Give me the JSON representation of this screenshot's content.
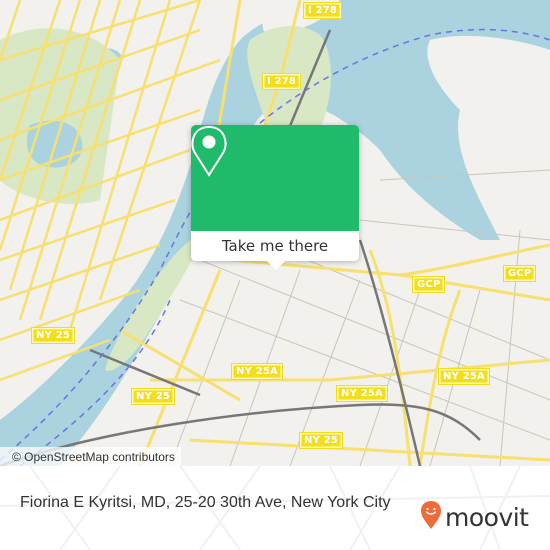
{
  "map": {
    "highway_shields": [
      {
        "label": "I 278",
        "route": "I-278"
      },
      {
        "label": "I 278",
        "route": "I-278"
      },
      {
        "label": "GCP",
        "route": "Grand Central Parkway"
      },
      {
        "label": "GCP",
        "route": "Grand Central Parkway"
      },
      {
        "label": "NY 25",
        "route": "NY-25"
      },
      {
        "label": "NY 25",
        "route": "NY-25"
      },
      {
        "label": "NY 25A",
        "route": "NY-25A"
      },
      {
        "label": "NY 25A",
        "route": "NY-25A"
      },
      {
        "label": "NY 25A",
        "route": "NY-25A"
      },
      {
        "label": "NY 25",
        "route": "NY-25"
      }
    ],
    "attribution": "© OpenStreetMap contributors",
    "colors": {
      "land": "#f2f1ed",
      "water": "#aad3df",
      "park": "#d8e8c4",
      "road": "#f7e06e",
      "rail": "#8a8a8a",
      "ferry": "#6b73e0"
    }
  },
  "popup": {
    "icon": "map-pin-icon",
    "button_label": "Take me there",
    "accent_color": "#1fbb6b"
  },
  "footer": {
    "place_text": "Fiorina E Kyritsi, MD, 25-20 30th Ave, New York City",
    "brand": "moovit",
    "brand_color": "#f06b3a"
  }
}
